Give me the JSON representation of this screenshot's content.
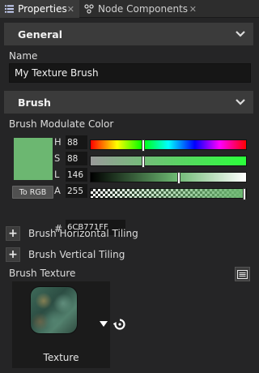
{
  "tabs": [
    {
      "label": "Properties",
      "icon": "list-icon",
      "active": true
    },
    {
      "label": "Node Components",
      "icon": "node-components-icon",
      "active": false
    }
  ],
  "sections": {
    "general": {
      "title": "General"
    },
    "brush": {
      "title": "Brush"
    }
  },
  "name_field": {
    "label": "Name",
    "value": "My Texture Brush"
  },
  "modulate": {
    "label": "Brush Modulate Color",
    "swatch_color": "#6cb771",
    "to_rgb_label": "To RGB",
    "channels": [
      {
        "letter": "H",
        "value": "88",
        "fraction": 0.34
      },
      {
        "letter": "S",
        "value": "88",
        "fraction": 0.34
      },
      {
        "letter": "L",
        "value": "146",
        "fraction": 0.57
      },
      {
        "letter": "A",
        "value": "255",
        "fraction": 1.0
      }
    ],
    "hex_prefix": "#",
    "hex_value": "6CB771FF"
  },
  "tiling": {
    "horizontal": "Brush Horizontal Tiling",
    "vertical": "Brush Vertical Tiling"
  },
  "texture": {
    "label": "Brush Texture",
    "thumb_label": "Texture"
  }
}
